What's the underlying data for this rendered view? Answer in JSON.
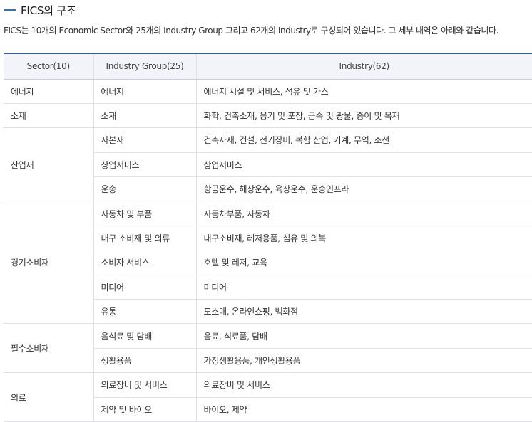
{
  "section_title": "FICS의 구조",
  "description": "FICS는 10개의 Economic Sector와 25개의 Industry Group 그리고 62개의 Industry로 구성되어 있습니다. 그 세부 내역은 아래와 같습니다.",
  "table": {
    "headers": {
      "sector": "Sector(10)",
      "group": "Industry Group(25)",
      "industry": "Industry(62)"
    },
    "sectors": [
      {
        "name": "에너지",
        "groups": [
          {
            "name": "에너지",
            "industries": "에너지 시설 및 서비스, 석유 및 가스"
          }
        ]
      },
      {
        "name": "소재",
        "groups": [
          {
            "name": "소재",
            "industries": "화학, 건축소재, 용기 및 포장, 금속 및 광물, 종이 및 목재"
          }
        ]
      },
      {
        "name": "산업재",
        "groups": [
          {
            "name": "자본재",
            "industries": "건축자재, 건설, 전기장비, 복합 산업, 기계, 무역, 조선"
          },
          {
            "name": "상업서비스",
            "industries": "상업서비스"
          },
          {
            "name": "운송",
            "industries": "항공운수, 해상운수, 육상운수, 운송인프라"
          }
        ]
      },
      {
        "name": "경기소비재",
        "groups": [
          {
            "name": "자동차 및 부품",
            "industries": "자동차부품, 자동차"
          },
          {
            "name": "내구 소비재 및 의류",
            "industries": "내구소비재, 레저용품, 섬유 및 의복"
          },
          {
            "name": "소비자 서비스",
            "industries": "호텔 및 레저, 교육"
          },
          {
            "name": "미디어",
            "industries": "미디어"
          },
          {
            "name": "유통",
            "industries": "도소매, 온라인쇼핑, 백화점"
          }
        ]
      },
      {
        "name": "필수소비재",
        "groups": [
          {
            "name": "음식료 및 담배",
            "industries": "음료, 식료품, 담배"
          },
          {
            "name": "생활용품",
            "industries": "가정생활용품, 개인생활용품"
          }
        ]
      },
      {
        "name": "의료",
        "groups": [
          {
            "name": "의료장비 및 서비스",
            "industries": "의료장비 및 서비스"
          },
          {
            "name": "제약 및 바이오",
            "industries": "바이오, 제약"
          }
        ]
      }
    ]
  }
}
